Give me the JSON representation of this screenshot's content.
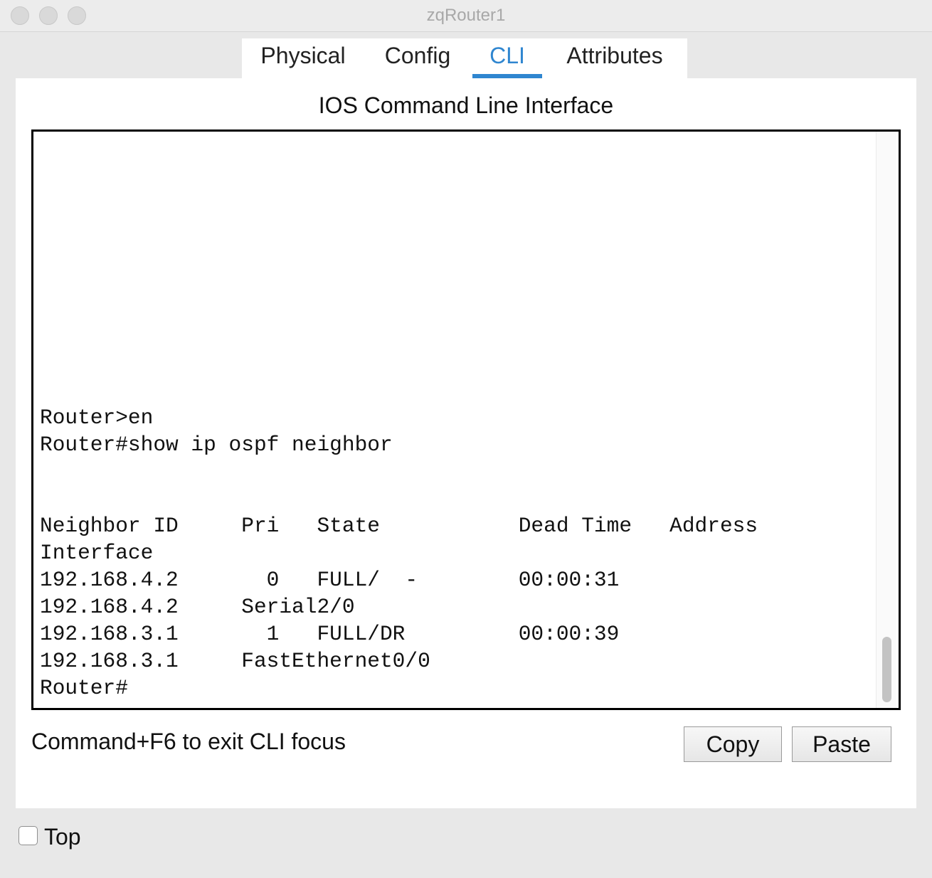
{
  "window": {
    "title": "zqRouter1"
  },
  "tabs": [
    {
      "label": "Physical"
    },
    {
      "label": "Config"
    },
    {
      "label": "CLI"
    },
    {
      "label": "Attributes"
    }
  ],
  "active_tab": "CLI",
  "panel": {
    "title": "IOS Command Line Interface"
  },
  "terminal": {
    "lines": [
      "Router>en",
      "Router#show ip ospf neighbor",
      "",
      "",
      "Neighbor ID     Pri   State           Dead Time   Address",
      "Interface",
      "192.168.4.2       0   FULL/  -        00:00:31",
      "192.168.4.2     Serial2/0",
      "192.168.3.1       1   FULL/DR         00:00:39",
      "192.168.3.1     FastEthernet0/0",
      "Router#"
    ]
  },
  "footer_hint": "Command+F6 to exit CLI focus",
  "buttons": {
    "copy": "Copy",
    "paste": "Paste"
  },
  "top_checkbox": {
    "label": "Top",
    "checked": false
  }
}
